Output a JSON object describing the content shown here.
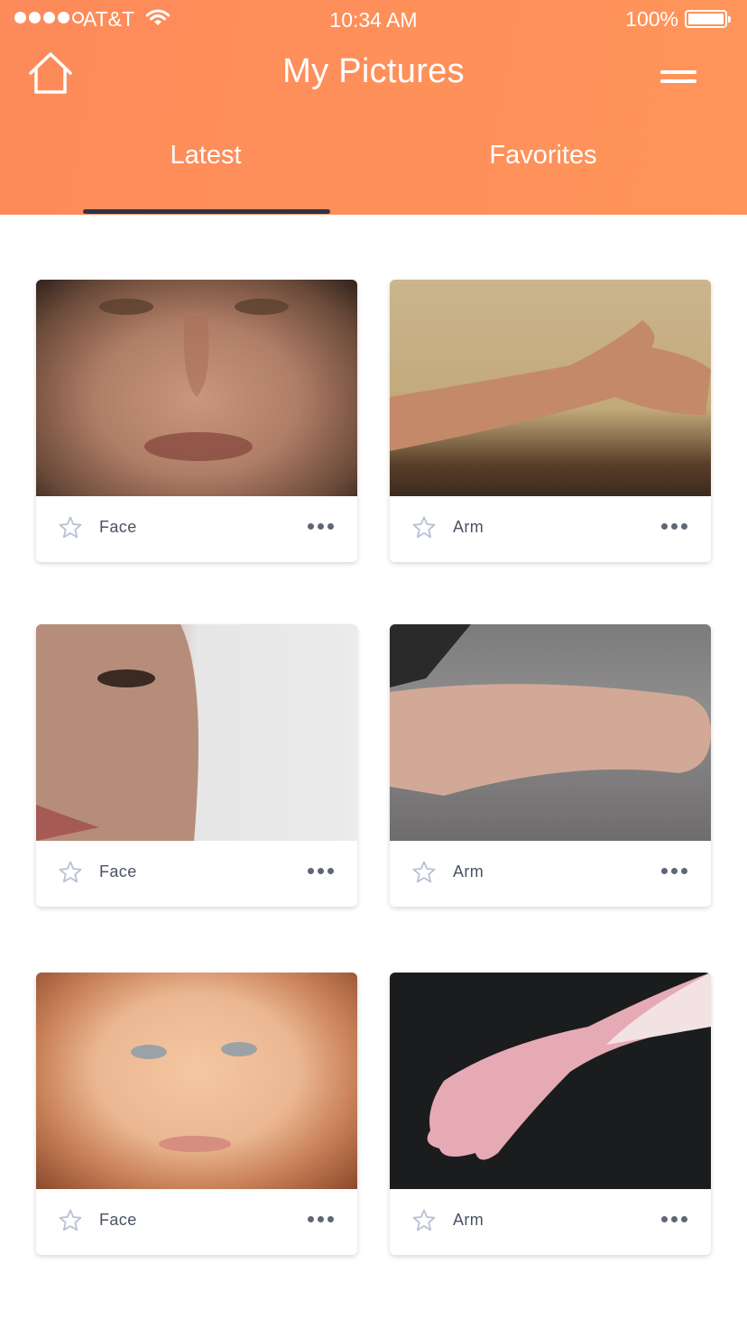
{
  "status_bar": {
    "carrier": "AT&T",
    "time": "10:34 AM",
    "battery_percent": "100%",
    "signal_strength": "4 of 5 dots",
    "battery_level": 1.0
  },
  "header": {
    "title": "My Pictures",
    "home_icon": "home-icon",
    "menu_icon": "hamburger-menu-icon",
    "background_color": "#fe8d5a"
  },
  "tabs": [
    {
      "label": "Latest",
      "active": true
    },
    {
      "label": "Favorites",
      "active": false
    }
  ],
  "tab_indicator_color": "#2d3348",
  "cards": [
    {
      "label": "Face",
      "photo": "close-up of a man's face",
      "favorite": false,
      "more_icon": "ellipsis-icon"
    },
    {
      "label": "Arm",
      "photo": "outstretched arm against beige wall",
      "favorite": false,
      "more_icon": "ellipsis-icon"
    },
    {
      "label": "Face",
      "photo": "half of a woman's face",
      "favorite": false,
      "more_icon": "ellipsis-icon"
    },
    {
      "label": "Arm",
      "photo": "forearm on grey surface",
      "favorite": false,
      "more_icon": "ellipsis-icon"
    },
    {
      "label": "Face",
      "photo": "front view of a woman's face",
      "favorite": false,
      "more_icon": "ellipsis-icon"
    },
    {
      "label": "Arm",
      "photo": "pale arm and hand on black background",
      "favorite": false,
      "more_icon": "ellipsis-icon"
    }
  ]
}
